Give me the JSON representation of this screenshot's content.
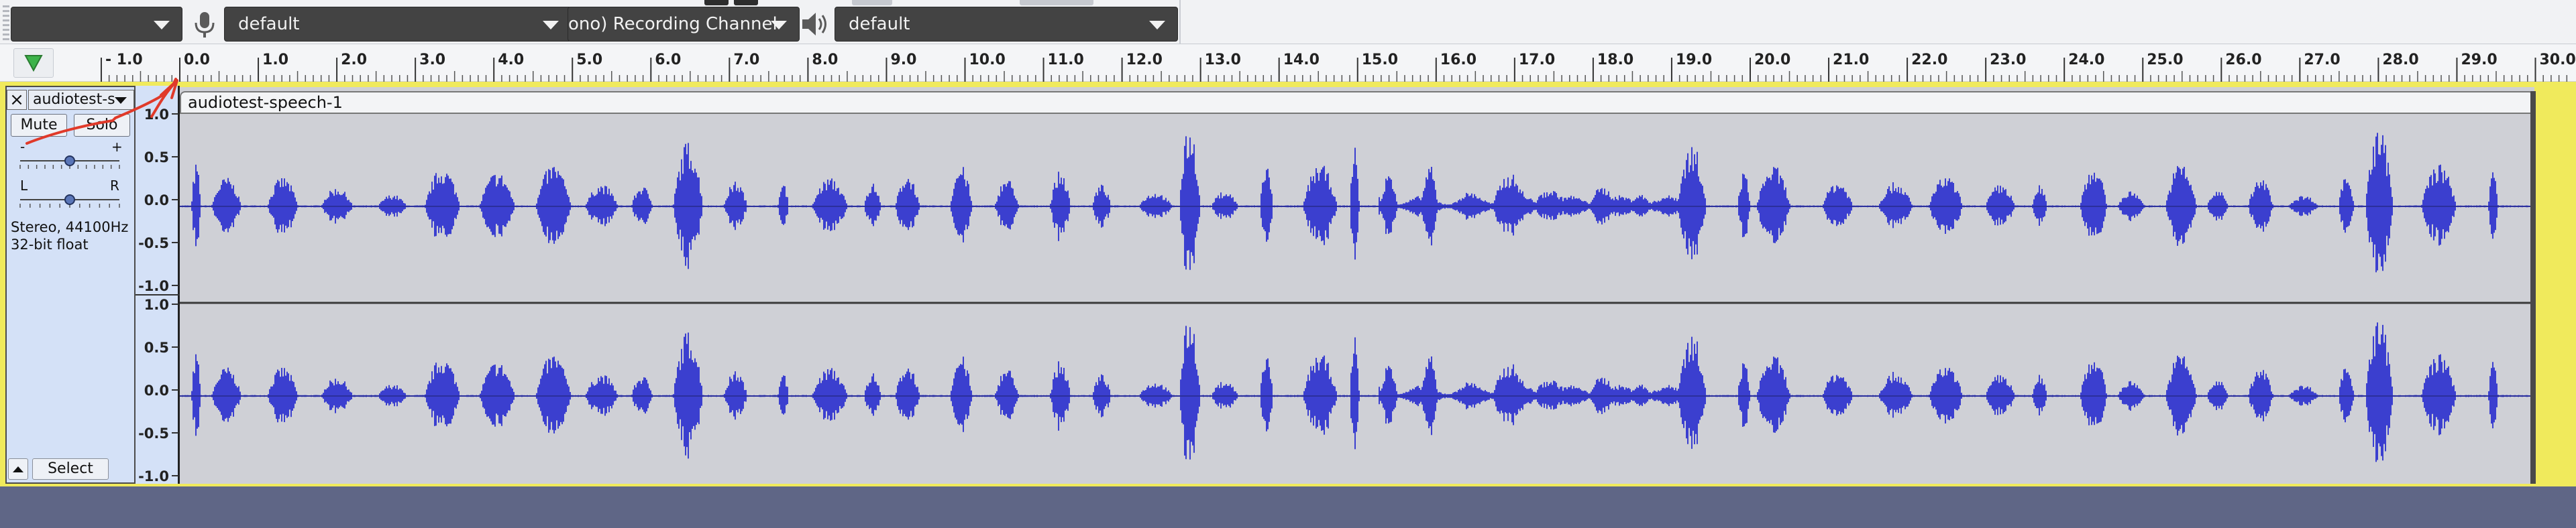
{
  "toolbar": {
    "host_combo_value": "",
    "recording_device": "default",
    "recording_channels": "ono) Recording Channel",
    "playback_device": "default",
    "mic_icon": "microphone-icon",
    "speaker_icon": "speaker-icon"
  },
  "ruler": {
    "ticks": [
      "- 1.0",
      "0.0",
      "1.0",
      "2.0",
      "3.0",
      "4.0",
      "5.0",
      "6.0",
      "7.0",
      "8.0",
      "9.0",
      "10.0",
      "11.0",
      "12.0",
      "13.0",
      "14.0",
      "15.0",
      "16.0",
      "17.0",
      "18.0",
      "19.0",
      "20.0",
      "21.0",
      "22.0",
      "23.0",
      "24.0",
      "25.0",
      "26.0",
      "27.0",
      "28.0",
      "29.0",
      "30.0"
    ]
  },
  "track": {
    "close_label": "×",
    "name": "audiotest-s",
    "mute_label": "Mute",
    "solo_label": "Solo",
    "gain_minus": "-",
    "gain_plus": "+",
    "pan_left": "L",
    "pan_right": "R",
    "info_line1": "Stereo, 44100Hz",
    "info_line2": "32-bit float",
    "select_label": "Select",
    "gain_level": 0.5,
    "pan_level": 0.5
  },
  "scale": {
    "channel1": [
      "1.0",
      "0.5",
      "0.0",
      "-0.5",
      "-1.0"
    ],
    "channel2": [
      "1.0",
      "0.5",
      "0.0",
      "-0.5",
      "-1.0"
    ]
  },
  "clip": {
    "name": "audiotest-speech-1"
  },
  "colors": {
    "waveform": "#3b3fcf",
    "clip_background": "#cfd0d6",
    "track_panel": "#d4e1f7",
    "selection_frame": "#f0ea5c",
    "workspace": "#5f6686"
  }
}
